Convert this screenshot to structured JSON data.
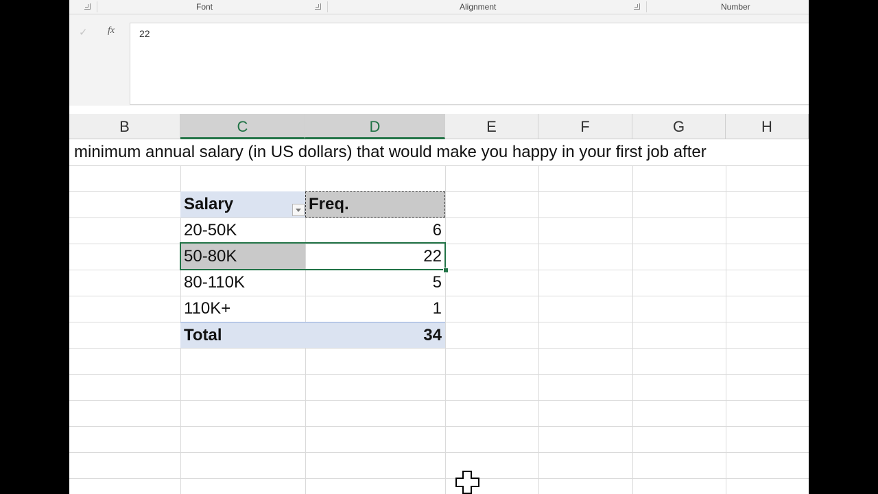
{
  "ribbon": {
    "groups": [
      "Font",
      "Alignment",
      "Number"
    ]
  },
  "formula_bar": {
    "value": "22"
  },
  "columns": [
    "B",
    "C",
    "D",
    "E",
    "F",
    "G",
    "H"
  ],
  "sheet": {
    "title_row": "minimum annual salary (in US dollars) that would make you happy in your first job after",
    "table": {
      "header": {
        "label": "Salary",
        "value": "Freq."
      },
      "rows": [
        {
          "label": "20-50K",
          "value": "6"
        },
        {
          "label": "50-80K",
          "value": "22"
        },
        {
          "label": "80-110K",
          "value": "5"
        },
        {
          "label": "110K+",
          "value": "1"
        }
      ],
      "total": {
        "label": "Total",
        "value": "34"
      }
    }
  },
  "colors": {
    "accent": "#217346",
    "table_header": "#dbe3f1"
  }
}
